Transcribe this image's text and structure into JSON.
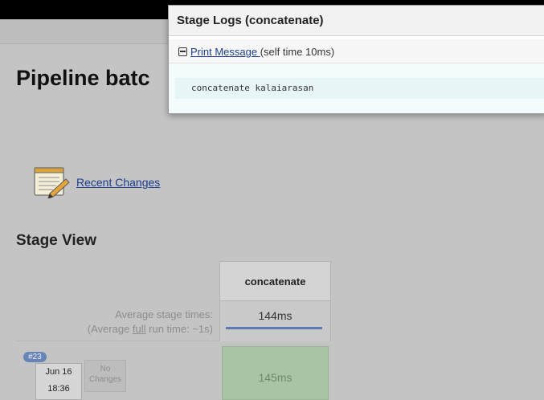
{
  "page": {
    "title": "Pipeline batc",
    "recent_changes": "Recent Changes",
    "stage_view_title": "Stage View"
  },
  "stage_view": {
    "avg_label_1": "Average stage times:",
    "avg_label_2_pre": "(Average ",
    "avg_label_2_u": "full",
    "avg_label_2_post": " run time: ~1s)",
    "stage_name": "concatenate",
    "stage_avg": "144ms",
    "build": {
      "number": "#23",
      "date": "Jun 16",
      "time": "18:36",
      "changes": "No Changes",
      "stage_time": "145ms"
    }
  },
  "modal": {
    "title": "Stage Logs (concatenate)",
    "step_name": "Print Message ",
    "step_meta": "(self time 10ms)",
    "log_text": "concatenate kalaiarasan"
  },
  "icons": {
    "notepad": "notepad-icon",
    "collapse": "collapse-icon"
  },
  "colors": {
    "stage_success": "#a9c4a4",
    "link": "#1b3d8c",
    "build_badge": "#6785b4"
  }
}
